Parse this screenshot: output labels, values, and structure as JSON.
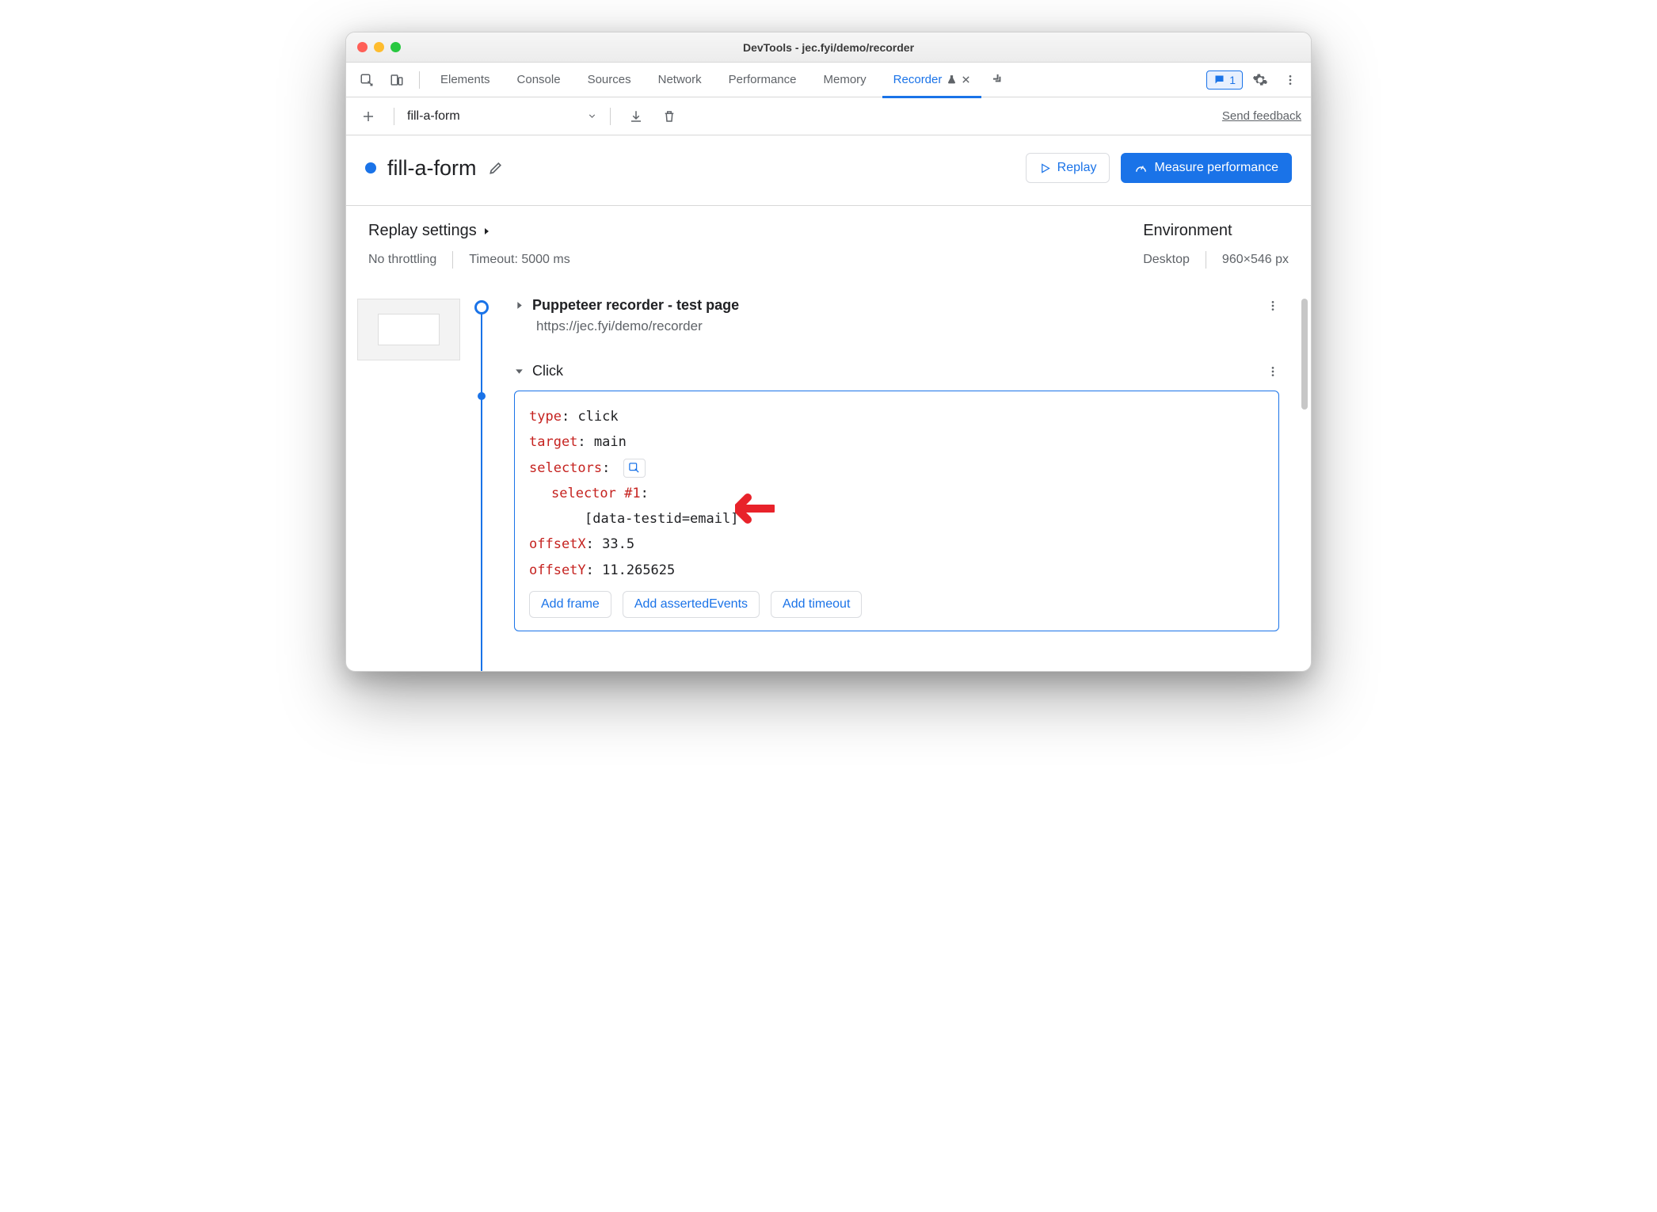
{
  "window": {
    "title": "DevTools - jec.fyi/demo/recorder"
  },
  "tabs": {
    "items": [
      "Elements",
      "Console",
      "Sources",
      "Network",
      "Performance",
      "Memory",
      "Recorder"
    ],
    "feedback_count": "1"
  },
  "toolbar": {
    "recording_name": "fill-a-form",
    "send_feedback": "Send feedback"
  },
  "header": {
    "title": "fill-a-form",
    "replay": "Replay",
    "measure": "Measure performance"
  },
  "replay_settings": {
    "heading": "Replay settings",
    "throttling": "No throttling",
    "timeout": "Timeout: 5000 ms"
  },
  "environment": {
    "heading": "Environment",
    "device": "Desktop",
    "size": "960×546 px"
  },
  "step1": {
    "title": "Puppeteer recorder - test page",
    "url": "https://jec.fyi/demo/recorder"
  },
  "step2": {
    "title": "Click",
    "details": {
      "type_key": "type",
      "type_val": "click",
      "target_key": "target",
      "target_val": "main",
      "selectors_key": "selectors",
      "selector1_label": "selector #1",
      "selector1_val": "[data-testid=email]",
      "offsetX_key": "offsetX",
      "offsetX_val": "33.5",
      "offsetY_key": "offsetY",
      "offsetY_val": "11.265625"
    },
    "add_frame": "Add frame",
    "add_asserted": "Add assertedEvents",
    "add_timeout": "Add timeout"
  }
}
